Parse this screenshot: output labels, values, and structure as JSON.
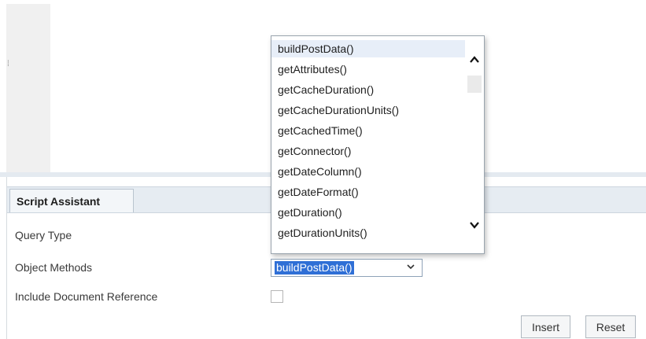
{
  "panel": {
    "tab_label": "Script Assistant",
    "labels": {
      "query_type": "Query Type",
      "object_methods": "Object Methods",
      "include_document_reference": "Include Document Reference"
    },
    "object_methods_value": "buildPostData()",
    "include_document_reference_checked": false,
    "buttons": {
      "insert": "Insert",
      "reset": "Reset"
    }
  },
  "dropdown": {
    "selected_index": 0,
    "options": [
      "buildPostData()",
      "getAttributes()",
      "getCacheDuration()",
      "getCacheDurationUnits()",
      "getCachedTime()",
      "getConnector()",
      "getDateColumn()",
      "getDateFormat()",
      "getDuration()",
      "getDurationUnits()",
      ""
    ]
  },
  "icons": {
    "scroll_up": "chevron-up-icon",
    "scroll_down": "chevron-down-icon",
    "select_caret": "chevron-down-icon"
  },
  "colors": {
    "selection_highlight": "#2f6fd6",
    "option_hover": "#e7eef8",
    "tabbar_bg": "#e6ecf2"
  }
}
